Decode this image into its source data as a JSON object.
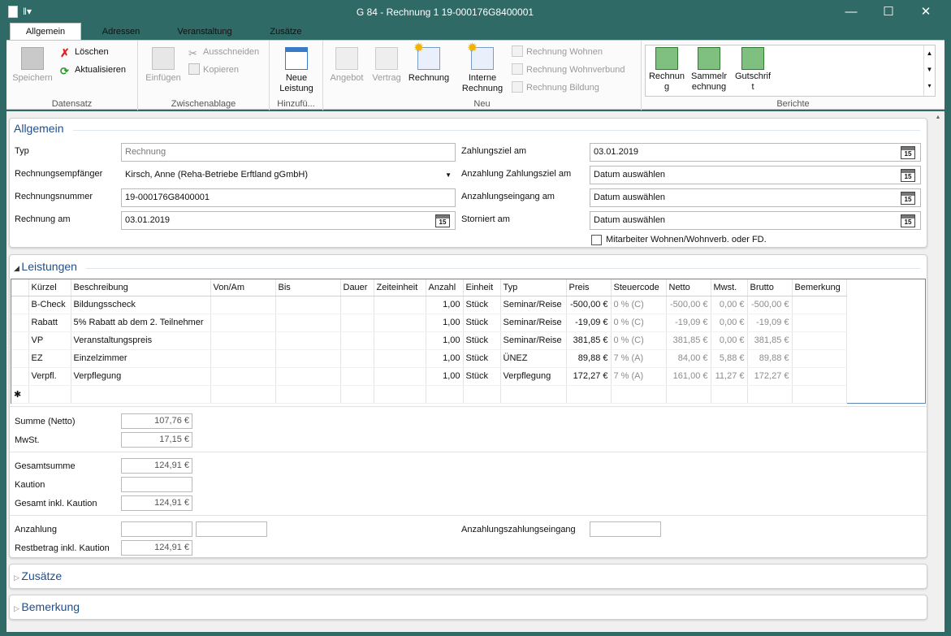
{
  "window": {
    "title": "G 84 - Rechnung 1 19-000176G8400001",
    "minimize": "—",
    "maximize": "☐",
    "close": "✕"
  },
  "tabs": [
    "Allgemein",
    "Adressen",
    "Veranstaltung",
    "Zusätze"
  ],
  "ribbon": {
    "datensatz": {
      "label": "Datensatz",
      "save": "Speichern",
      "delete": "Löschen",
      "refresh": "Aktualisieren"
    },
    "clipboard": {
      "label": "Zwischenablage",
      "paste": "Einfügen",
      "cut": "Ausschneiden",
      "copy": "Kopieren"
    },
    "add": {
      "label": "Hinzufü...",
      "new_service_1": "Neue",
      "new_service_2": "Leistung"
    },
    "new": {
      "label": "Neu",
      "offer": "Angebot",
      "contract": "Vertrag",
      "invoice": "Rechnung",
      "internal_1": "Interne",
      "internal_2": "Rechnung",
      "invoice_living": "Rechnung Wohnen",
      "invoice_living_assoc": "Rechnung Wohnverbund",
      "invoice_education": "Rechnung Bildung"
    },
    "reports": {
      "label": "Berichte",
      "r1a": "Rechnun",
      "r1b": "g",
      "r2a": "Sammelr",
      "r2b": "echnung",
      "r3a": "Gutschrif",
      "r3b": "t"
    }
  },
  "general": {
    "title": "Allgemein",
    "type_label": "Typ",
    "type_value": "Rechnung",
    "recipient_label": "Rechnungsempfänger",
    "recipient_value": "Kirsch, Anne (Reha-Betriebe Erftland gGmbH)",
    "number_label": "Rechnungsnummer",
    "number_value": "19-000176G8400001",
    "date_label": "Rechnung am",
    "date_value": "03.01.2019",
    "due_label": "Zahlungsziel am",
    "due_value": "03.01.2019",
    "deposit_due_label": "Anzahlung Zahlungsziel am",
    "deposit_due_value": "Datum auswählen",
    "deposit_in_label": "Anzahlungseingang am",
    "deposit_in_value": "Datum auswählen",
    "cancel_label": "Storniert am",
    "cancel_value": "Datum auswählen",
    "staff_check": "Mitarbeiter Wohnen/Wohnverb. oder FD.",
    "cal": "15"
  },
  "services": {
    "title": "Leistungen",
    "headers": [
      "Kürzel",
      "Beschreibung",
      "Von/Am",
      "Bis",
      "Dauer",
      "Zeiteinheit",
      "Anzahl",
      "Einheit",
      "Typ",
      "Preis",
      "Steuercode",
      "Netto",
      "Mwst.",
      "Brutto",
      "Bemerkung"
    ],
    "rows": [
      [
        "B-Check",
        "Bildungsscheck",
        "",
        "",
        "",
        "",
        "1,00",
        "Stück",
        "Seminar/Reise",
        "-500,00 €",
        "0 % (C)",
        "-500,00 €",
        "0,00 €",
        "-500,00 €",
        ""
      ],
      [
        "Rabatt",
        "5% Rabatt ab dem 2. Teilnehmer",
        "",
        "",
        "",
        "",
        "1,00",
        "Stück",
        "Seminar/Reise",
        "-19,09 €",
        "0 % (C)",
        "-19,09 €",
        "0,00 €",
        "-19,09 €",
        ""
      ],
      [
        "VP",
        "Veranstaltungspreis",
        "",
        "",
        "",
        "",
        "1,00",
        "Stück",
        "Seminar/Reise",
        "381,85 €",
        "0 % (C)",
        "381,85 €",
        "0,00 €",
        "381,85 €",
        ""
      ],
      [
        "EZ",
        "Einzelzimmer",
        "",
        "",
        "",
        "",
        "1,00",
        "Stück",
        "ÜNEZ",
        "89,88 €",
        "7 % (A)",
        "84,00 €",
        "5,88 €",
        "89,88 €",
        ""
      ],
      [
        "Verpfl.",
        "Verpflegung",
        "",
        "",
        "",
        "",
        "1,00",
        "Stück",
        "Verpflegung",
        "172,27 €",
        "7 % (A)",
        "161,00 €",
        "11,27 €",
        "172,27 €",
        ""
      ]
    ],
    "new_row": "✱"
  },
  "totals": {
    "net_label": "Summe (Netto)",
    "net": "107,76 €",
    "vat_label": "MwSt.",
    "vat": "17,15 €",
    "total_label": "Gesamtsumme",
    "total": "124,91 €",
    "deposit_label": "Kaution",
    "deposit": "",
    "total_deposit_label": "Gesamt inkl. Kaution",
    "total_deposit": "124,91 €",
    "prepay_label": "Anzahlung",
    "prepay": "",
    "prepay2": "",
    "prepay_in_label": "Anzahlungszahlungseingang",
    "prepay_in": "",
    "rest_label": "Restbetrag inkl. Kaution",
    "rest": "124,91 €"
  },
  "sections": {
    "extras": "Zusätze",
    "notes": "Bemerkung"
  }
}
